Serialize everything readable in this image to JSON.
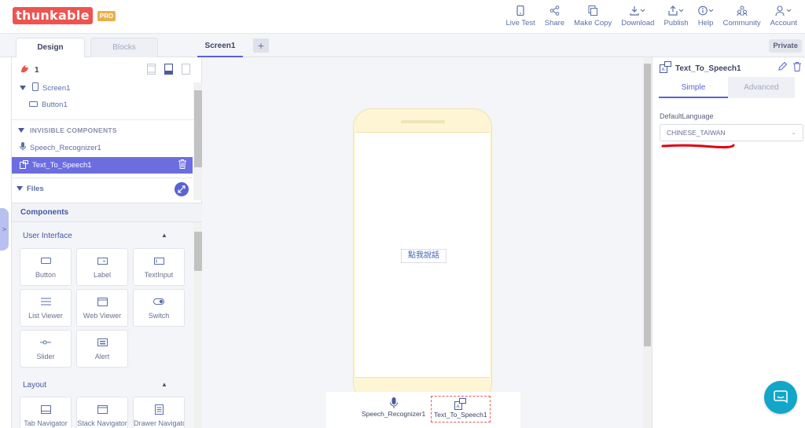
{
  "app": {
    "logo_text": "thunkable",
    "logo_badge": "PRO"
  },
  "nav": [
    {
      "label": "Live Test",
      "icon": "phone-icon"
    },
    {
      "label": "Share",
      "icon": "share-icon"
    },
    {
      "label": "Make Copy",
      "icon": "copy-icon"
    },
    {
      "label": "Download",
      "icon": "download-icon"
    },
    {
      "label": "Publish",
      "icon": "publish-icon"
    },
    {
      "label": "Help",
      "icon": "help-icon"
    },
    {
      "label": "Community",
      "icon": "community-icon"
    },
    {
      "label": "Account",
      "icon": "account-icon"
    }
  ],
  "tabs": {
    "design": "Design",
    "blocks": "Blocks",
    "screen": "Screen1",
    "add": "+",
    "visibility": "Private"
  },
  "tree": {
    "project_name": "1",
    "screen": "Screen1",
    "button": "Button1",
    "invisible_title": "INVISIBLE COMPONENTS",
    "speech_recognizer": "Speech_Recognizer1",
    "text_to_speech": "Text_To_Speech1",
    "files": "Files"
  },
  "components": {
    "title": "Components",
    "user_interface": {
      "title": "User Interface",
      "items": [
        {
          "label": "Button",
          "icon": "button-icon"
        },
        {
          "label": "Label",
          "icon": "label-icon"
        },
        {
          "label": "TextInput",
          "icon": "textinput-icon"
        },
        {
          "label": "List Viewer",
          "icon": "list-icon"
        },
        {
          "label": "Web Viewer",
          "icon": "web-icon"
        },
        {
          "label": "Switch",
          "icon": "switch-icon"
        },
        {
          "label": "Slider",
          "icon": "slider-icon"
        },
        {
          "label": "Alert",
          "icon": "alert-icon"
        }
      ]
    },
    "layout": {
      "title": "Layout",
      "items": [
        {
          "label": "Tab Navigator",
          "icon": "tab-navigator-icon"
        },
        {
          "label": "Stack Navigator",
          "icon": "stack-navigator-icon"
        },
        {
          "label": "Drawer Navigator",
          "icon": "drawer-navigator-icon"
        }
      ]
    }
  },
  "canvas": {
    "button_text": "點我說話",
    "invisible": [
      "Speech_Recognizer1",
      "Text_To_Speech1"
    ]
  },
  "properties": {
    "component": "Text_To_Speech1",
    "tab_simple": "Simple",
    "tab_advanced": "Advanced",
    "field_label": "DefaultLanguage",
    "field_value": "CHINESE_TAIWAN"
  },
  "colors": {
    "brand": "#ef5350",
    "accent": "#5a62d6",
    "selected": "#6c6ee0",
    "annotation": "#e3000f",
    "chat": "#12a6c8"
  }
}
